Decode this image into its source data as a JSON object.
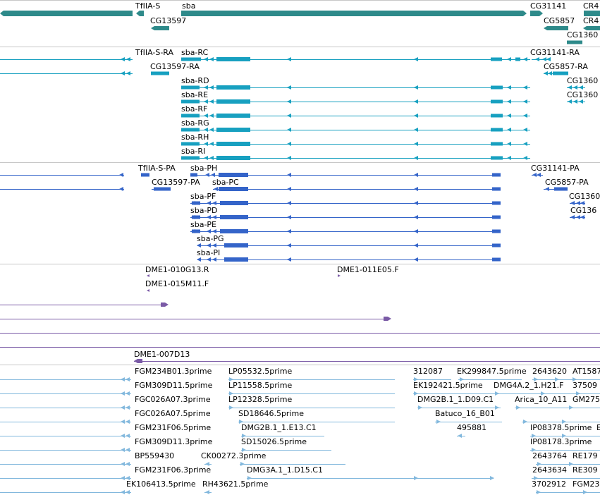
{
  "colors": {
    "gene": "#2e8a8a",
    "flybase_transcript": "#17a0c0",
    "refseq_transcript": "#3464c9",
    "bac_end": "#7a5aa6",
    "est": "#82b8dd",
    "separator": "#c8c8c8"
  },
  "tracks": {
    "genes": {
      "labels": {
        "tfiia_s": "TfIIA-S",
        "sba": "sba",
        "cg31141": "CG31141",
        "cr4": "CR4",
        "cg13597": "CG13597",
        "cg5857": "CG5857",
        "cr4b": "CR4",
        "cg1360": "CG1360"
      }
    },
    "flybase_transcripts": {
      "labels": {
        "tfiia_s_ra": "TfIIA-S-RA",
        "sba_rc": "sba-RC",
        "cg31141_ra": "CG31141-RA",
        "cg13597_ra": "CG13597-RA",
        "cg5857_ra": "CG5857-RA",
        "sba_rd": "sba-RD",
        "cg1360_a": "CG1360",
        "sba_re": "sba-RE",
        "cg1360_b": "CG1360",
        "sba_rf": "sba-RF",
        "sba_rg": "sba-RG",
        "sba_rh": "sba-RH",
        "sba_ri": "sba-RI"
      }
    },
    "refseq_transcripts": {
      "labels": {
        "tfiia_s_pa": "TfIIA-S-PA",
        "sba_ph": "sba-PH",
        "cg31141_pa": "CG31141-PA",
        "cg13597_pa": "CG13597-PA",
        "sba_pc": "sba-PC",
        "cg5857_pa": "CG5857-PA",
        "sba_pf": "sba-PF",
        "cg1360_c": "CG1360",
        "sba_pd": "sba-PD",
        "cg136": "CG136",
        "sba_pe": "sba-PE",
        "sba_pg": "sba-PG",
        "sba_pi": "sba-PI"
      }
    },
    "bac_ends": {
      "labels": {
        "dme1_010g13_r": "DME1-010G13.R",
        "dme1_011e05_f": "DME1-011E05.F",
        "dme1_015m11_f": "DME1-015M11.F",
        "dme1_007d13": "DME1-007D13"
      }
    },
    "ests": {
      "labels": {
        "fgm234b01": "FGM234B01.3prime",
        "lp05532": "LP05532.5prime",
        "e312087": "312087",
        "ek299847": "EK299847.5prime",
        "e2643620": "2643620",
        "at1587": "AT1587",
        "fgm309d11_5": "FGM309D11.5prime",
        "lp11558": "LP11558.5prime",
        "ek192421": "EK192421.5prime",
        "dmg4a2": "DMG4A.2_1.H21.F",
        "e37509": "37509",
        "fgc026a07_3": "FGC026A07.3prime",
        "lp12328": "LP12328.5prime",
        "dmg2b1_d09": "DMG2B.1_1.D09.C1",
        "arica": "Arica_10_A11",
        "gm275": "GM275",
        "fgc026a07_5": "FGC026A07.5prime",
        "sd18646": "SD18646.5prime",
        "batuco": "Batuco_16_B01",
        "fgm231f06_5": "FGM231F06.5prime",
        "dmg2b1_e13": "DMG2B.1_1.E13.C1",
        "e495881": "495881",
        "ip08378": "IP08378.5prime",
        "e_b": "E",
        "fgm309d11_3": "FGM309D11.3prime",
        "sd15026": "SD15026.5prime",
        "ip08178": "IP08178.3prime",
        "bp559430": "BP559430",
        "ck00272": "CK00272.3prime",
        "e2643764": "2643764",
        "re179": "RE179",
        "fgm231f06_3": "FGM231F06.3prime",
        "dmg3a1": "DMG3A.1_1.D15.C1",
        "e2643634": "2643634",
        "re309": "RE309",
        "ek106413": "EK106413.5prime",
        "rh43621": "RH43621.5prime",
        "e3702912": "3702912",
        "fgm23": "FGM23"
      }
    }
  }
}
